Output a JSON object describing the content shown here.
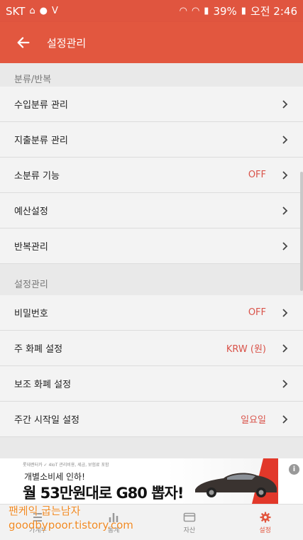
{
  "status": {
    "carrier": "SKT",
    "battery": "39%",
    "time": "오전 2:46"
  },
  "appbar": {
    "title": "설정관리"
  },
  "sections": [
    {
      "header": "분류/반복",
      "items": [
        {
          "label": "수입분류 관리",
          "value": ""
        },
        {
          "label": "지출분류 관리",
          "value": ""
        },
        {
          "label": "소분류 기능",
          "value": "OFF"
        },
        {
          "label": "예산설정",
          "value": ""
        },
        {
          "label": "반복관리",
          "value": ""
        }
      ]
    },
    {
      "header": "설정관리",
      "items": [
        {
          "label": "비밀번호",
          "value": "OFF"
        },
        {
          "label": "주 화폐 설정",
          "value": "KRW (원)"
        },
        {
          "label": "보조 화폐 설정",
          "value": ""
        },
        {
          "label": "주간 시작일 설정",
          "value": "일요일"
        }
      ]
    }
  ],
  "ad": {
    "small_text": "롯데렌터카 ✓ 4IoT 관리비용, 세금, 보험료 포함",
    "line1": "개별소비세 인하!",
    "line2": "월 53만원대로 G80 뽑자!",
    "info": "i"
  },
  "nav": [
    {
      "label": "가계부",
      "icon": "list-icon"
    },
    {
      "label": "통계",
      "icon": "bar-chart-icon"
    },
    {
      "label": "자산",
      "icon": "card-icon"
    },
    {
      "label": "설정",
      "icon": "gear-icon"
    }
  ],
  "watermark": {
    "line1": "팬케익 굽는남자",
    "line2": "goodbypoor.tistory.com"
  },
  "colors": {
    "accent": "#e2573f",
    "value_red": "#d9534a"
  }
}
